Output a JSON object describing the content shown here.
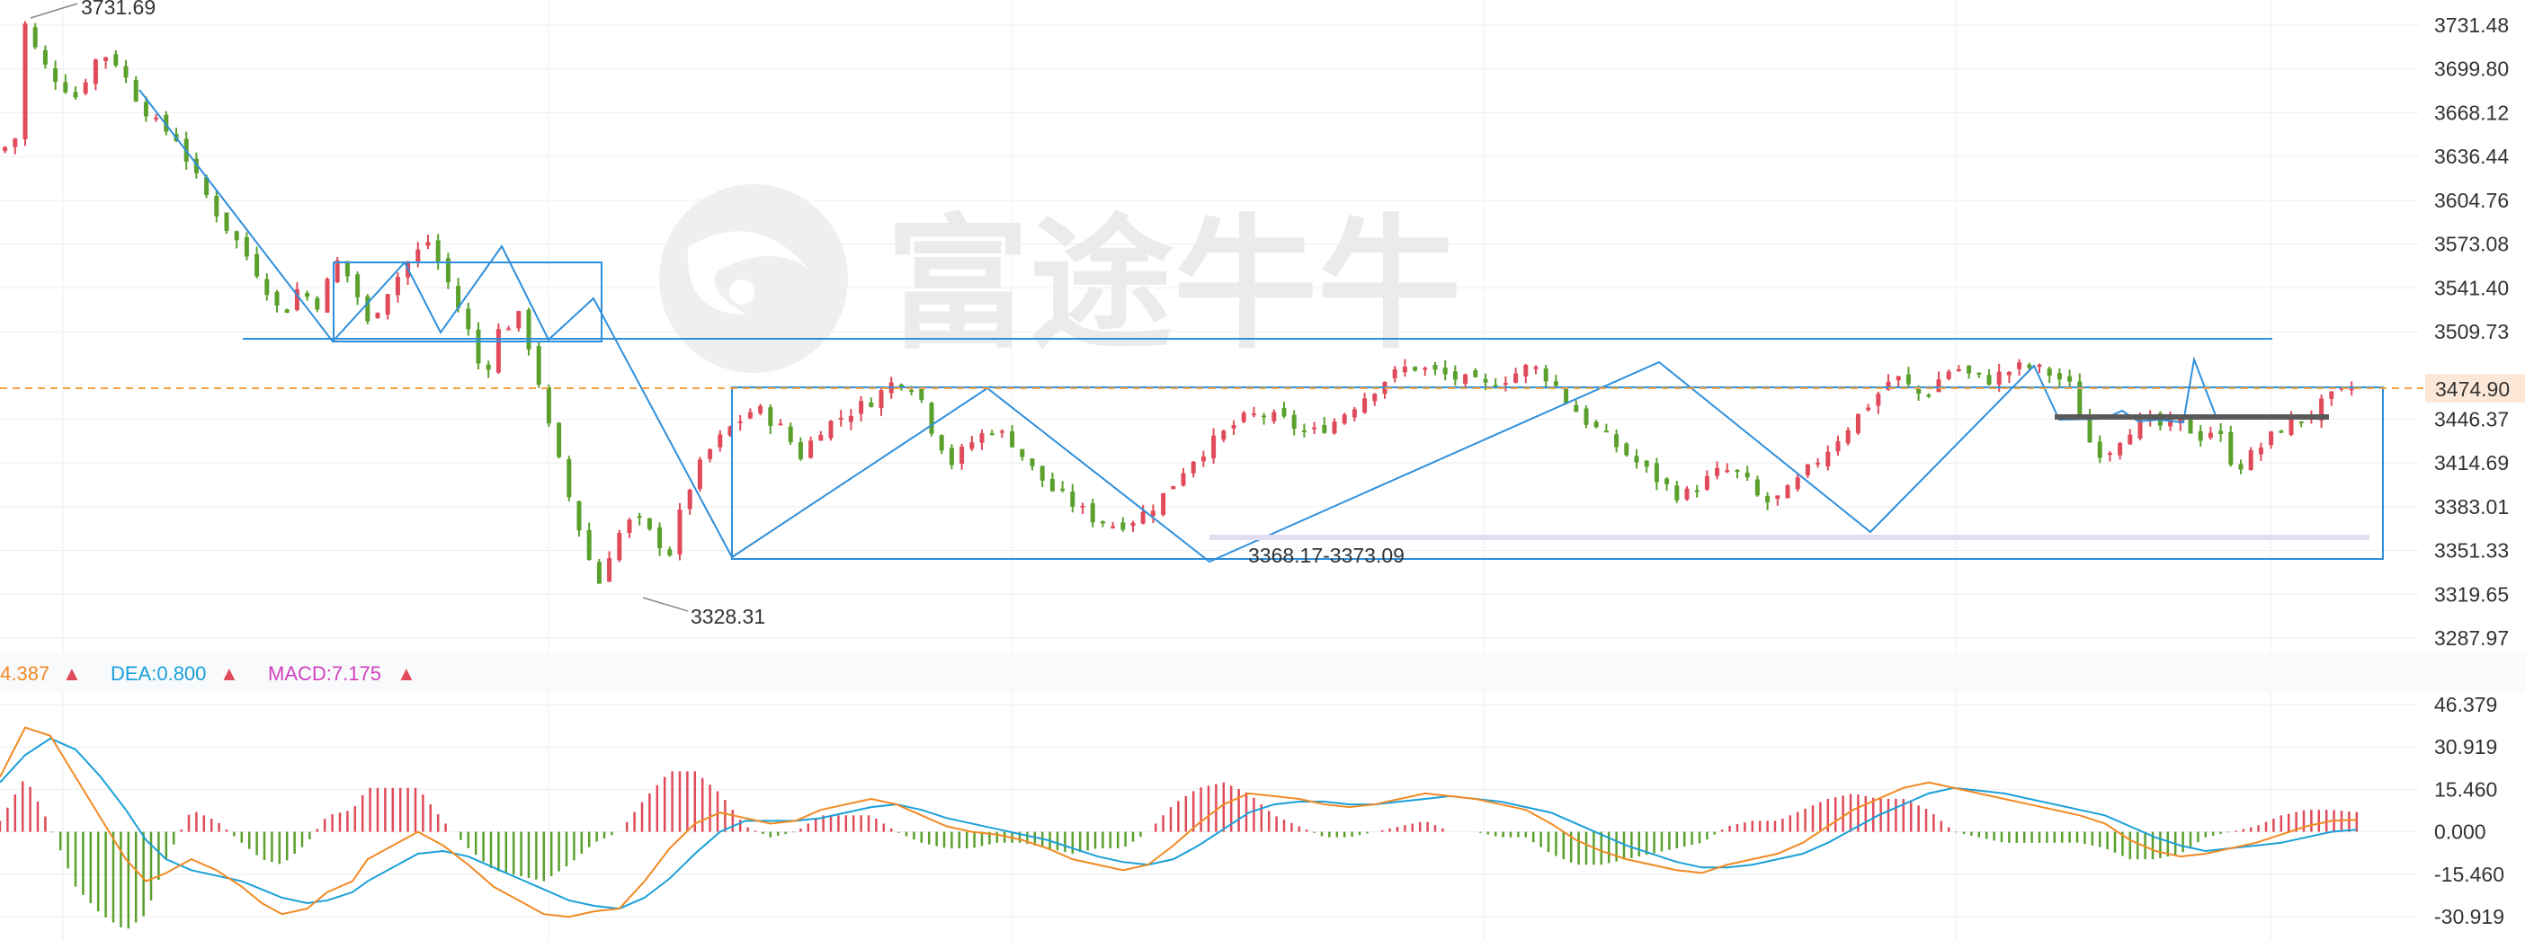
{
  "watermark": {
    "text": "富途牛牛"
  },
  "colors": {
    "up": "#e04a5a",
    "down": "#5aa02c",
    "drawing": "#2f8fdb",
    "current_line": "#f5a142",
    "current_bg": "#fde8d8",
    "current_text": "#e5322d",
    "dif": "#f08a24",
    "dea": "#1aa0d8",
    "macd_label": "#d040c0",
    "grid": "#eeeeee"
  },
  "price_axis": {
    "ticks": [
      "3731.48",
      "3699.80",
      "3668.12",
      "3636.44",
      "3604.76",
      "3573.08",
      "3541.40",
      "3509.73",
      "3446.37",
      "3414.69",
      "3383.01",
      "3351.33",
      "3319.65",
      "3287.97"
    ],
    "current_price": "3474.90"
  },
  "annotations": {
    "high": "3731.69",
    "low": "3328.31",
    "range": "3368.17-3373.09"
  },
  "indicator": {
    "dif_label": ":4.387",
    "dif_arrow": "▲",
    "dea_label": "DEA:0.800",
    "dea_arrow": "▲",
    "macd_label": "MACD:7.175",
    "macd_arrow": "▲",
    "ticks": [
      "46.379",
      "30.919",
      "15.460",
      "0.000",
      "-15.460",
      "-30.919"
    ]
  },
  "chart_data": {
    "type": "candlestick",
    "price_range": [
      3287.97,
      3731.48
    ],
    "close_path": [
      [
        0,
        3640
      ],
      [
        6,
        3650
      ],
      [
        10,
        3731.69
      ],
      [
        16,
        3705
      ],
      [
        24,
        3690
      ],
      [
        30,
        3680
      ],
      [
        36,
        3700
      ],
      [
        40,
        3712
      ],
      [
        46,
        3705
      ],
      [
        54,
        3680
      ],
      [
        62,
        3660
      ],
      [
        70,
        3650
      ],
      [
        78,
        3620
      ],
      [
        88,
        3590
      ],
      [
        96,
        3570
      ],
      [
        104,
        3548
      ],
      [
        112,
        3520
      ],
      [
        118,
        3540
      ],
      [
        126,
        3530
      ],
      [
        134,
        3560
      ],
      [
        140,
        3545
      ],
      [
        146,
        3515
      ],
      [
        154,
        3540
      ],
      [
        162,
        3560
      ],
      [
        170,
        3575
      ],
      [
        178,
        3545
      ],
      [
        186,
        3510
      ],
      [
        192,
        3475
      ],
      [
        198,
        3510
      ],
      [
        206,
        3520
      ],
      [
        212,
        3490
      ],
      [
        218,
        3440
      ],
      [
        226,
        3390
      ],
      [
        234,
        3345
      ],
      [
        238,
        3328.31
      ],
      [
        244,
        3360
      ],
      [
        252,
        3375
      ],
      [
        260,
        3360
      ],
      [
        266,
        3350
      ],
      [
        272,
        3390
      ],
      [
        280,
        3420
      ],
      [
        290,
        3440
      ],
      [
        300,
        3455
      ],
      [
        310,
        3440
      ],
      [
        318,
        3420
      ],
      [
        326,
        3440
      ],
      [
        336,
        3450
      ],
      [
        346,
        3460
      ],
      [
        356,
        3475
      ],
      [
        364,
        3470
      ],
      [
        370,
        3440
      ],
      [
        378,
        3415
      ],
      [
        386,
        3430
      ],
      [
        394,
        3440
      ],
      [
        402,
        3430
      ],
      [
        410,
        3410
      ],
      [
        418,
        3395
      ],
      [
        426,
        3385
      ],
      [
        434,
        3375
      ],
      [
        442,
        3370
      ],
      [
        448,
        3372
      ],
      [
        456,
        3380
      ],
      [
        464,
        3395
      ],
      [
        472,
        3415
      ],
      [
        482,
        3430
      ],
      [
        492,
        3445
      ],
      [
        500,
        3450
      ],
      [
        510,
        3445
      ],
      [
        520,
        3435
      ],
      [
        530,
        3445
      ],
      [
        540,
        3460
      ],
      [
        550,
        3475
      ],
      [
        560,
        3485
      ],
      [
        570,
        3480
      ],
      [
        580,
        3475
      ],
      [
        590,
        3470
      ],
      [
        600,
        3478
      ],
      [
        608,
        3485
      ],
      [
        616,
        3475
      ],
      [
        622,
        3460
      ],
      [
        630,
        3445
      ],
      [
        640,
        3430
      ],
      [
        650,
        3415
      ],
      [
        660,
        3400
      ],
      [
        668,
        3390
      ],
      [
        676,
        3400
      ],
      [
        684,
        3410
      ],
      [
        692,
        3405
      ],
      [
        700,
        3385
      ],
      [
        708,
        3390
      ],
      [
        716,
        3405
      ],
      [
        726,
        3425
      ],
      [
        736,
        3445
      ],
      [
        746,
        3465
      ],
      [
        752,
        3478
      ],
      [
        758,
        3470
      ],
      [
        764,
        3462
      ],
      [
        770,
        3475
      ],
      [
        776,
        3485
      ],
      [
        782,
        3478
      ],
      [
        790,
        3475
      ],
      [
        796,
        3480
      ],
      [
        804,
        3485
      ],
      [
        810,
        3482
      ],
      [
        816,
        3478
      ],
      [
        822,
        3470
      ],
      [
        830,
        3430
      ],
      [
        836,
        3420
      ],
      [
        840,
        3430
      ],
      [
        846,
        3440
      ],
      [
        852,
        3445
      ],
      [
        860,
        3440
      ],
      [
        868,
        3445
      ],
      [
        872,
        3432
      ],
      [
        880,
        3440
      ],
      [
        884,
        3425
      ],
      [
        888,
        3410
      ],
      [
        894,
        3420
      ],
      [
        900,
        3430
      ],
      [
        906,
        3440
      ],
      [
        912,
        3445
      ],
      [
        918,
        3450
      ],
      [
        924,
        3460
      ],
      [
        930,
        3465
      ],
      [
        936,
        3470
      ]
    ],
    "macd_range": [
      -30.919,
      46.379
    ],
    "dif_path": [
      [
        0,
        20
      ],
      [
        10,
        38
      ],
      [
        20,
        35
      ],
      [
        30,
        20
      ],
      [
        40,
        5
      ],
      [
        50,
        -10
      ],
      [
        58,
        -18
      ],
      [
        66,
        -15
      ],
      [
        76,
        -10
      ],
      [
        86,
        -14
      ],
      [
        96,
        -20
      ],
      [
        104,
        -26
      ],
      [
        112,
        -30
      ],
      [
        122,
        -28
      ],
      [
        130,
        -22
      ],
      [
        140,
        -18
      ],
      [
        146,
        -10
      ],
      [
        156,
        -5
      ],
      [
        166,
        0
      ],
      [
        176,
        -5
      ],
      [
        186,
        -12
      ],
      [
        196,
        -20
      ],
      [
        206,
        -25
      ],
      [
        216,
        -30
      ],
      [
        226,
        -31
      ],
      [
        236,
        -29
      ],
      [
        246,
        -28
      ],
      [
        256,
        -18
      ],
      [
        266,
        -6
      ],
      [
        276,
        3
      ],
      [
        286,
        7
      ],
      [
        296,
        5
      ],
      [
        306,
        3
      ],
      [
        316,
        4
      ],
      [
        326,
        8
      ],
      [
        336,
        10
      ],
      [
        346,
        12
      ],
      [
        356,
        10
      ],
      [
        366,
        6
      ],
      [
        376,
        2
      ],
      [
        386,
        0
      ],
      [
        396,
        -1
      ],
      [
        406,
        -3
      ],
      [
        416,
        -6
      ],
      [
        426,
        -10
      ],
      [
        436,
        -12
      ],
      [
        446,
        -14
      ],
      [
        456,
        -12
      ],
      [
        466,
        -5
      ],
      [
        476,
        3
      ],
      [
        486,
        10
      ],
      [
        496,
        14
      ],
      [
        506,
        13
      ],
      [
        516,
        12
      ],
      [
        526,
        10
      ],
      [
        536,
        9
      ],
      [
        546,
        10
      ],
      [
        556,
        12
      ],
      [
        566,
        14
      ],
      [
        576,
        13
      ],
      [
        586,
        12
      ],
      [
        596,
        10
      ],
      [
        606,
        8
      ],
      [
        616,
        3
      ],
      [
        626,
        -3
      ],
      [
        636,
        -7
      ],
      [
        646,
        -10
      ],
      [
        656,
        -12
      ],
      [
        666,
        -14
      ],
      [
        676,
        -15
      ],
      [
        686,
        -12
      ],
      [
        696,
        -10
      ],
      [
        706,
        -8
      ],
      [
        716,
        -4
      ],
      [
        726,
        2
      ],
      [
        736,
        8
      ],
      [
        746,
        12
      ],
      [
        756,
        16
      ],
      [
        766,
        18
      ],
      [
        776,
        16
      ],
      [
        786,
        14
      ],
      [
        796,
        12
      ],
      [
        806,
        10
      ],
      [
        816,
        8
      ],
      [
        826,
        6
      ],
      [
        836,
        3
      ],
      [
        846,
        -3
      ],
      [
        856,
        -7
      ],
      [
        866,
        -9
      ],
      [
        876,
        -8
      ],
      [
        886,
        -6
      ],
      [
        896,
        -4
      ],
      [
        906,
        -1
      ],
      [
        916,
        2
      ],
      [
        926,
        4
      ],
      [
        936,
        4.387
      ]
    ],
    "dea_path": [
      [
        0,
        18
      ],
      [
        10,
        28
      ],
      [
        20,
        34
      ],
      [
        30,
        30
      ],
      [
        40,
        20
      ],
      [
        50,
        8
      ],
      [
        58,
        -3
      ],
      [
        66,
        -10
      ],
      [
        76,
        -14
      ],
      [
        86,
        -16
      ],
      [
        96,
        -18
      ],
      [
        104,
        -21
      ],
      [
        112,
        -24
      ],
      [
        122,
        -26
      ],
      [
        130,
        -25
      ],
      [
        140,
        -22
      ],
      [
        146,
        -18
      ],
      [
        156,
        -13
      ],
      [
        166,
        -8
      ],
      [
        176,
        -7
      ],
      [
        186,
        -9
      ],
      [
        196,
        -13
      ],
      [
        206,
        -17
      ],
      [
        216,
        -21
      ],
      [
        226,
        -25
      ],
      [
        236,
        -27
      ],
      [
        246,
        -28
      ],
      [
        256,
        -24
      ],
      [
        266,
        -17
      ],
      [
        276,
        -8
      ],
      [
        286,
        0
      ],
      [
        296,
        4
      ],
      [
        306,
        4
      ],
      [
        316,
        4
      ],
      [
        326,
        5
      ],
      [
        336,
        7
      ],
      [
        346,
        9
      ],
      [
        356,
        10
      ],
      [
        366,
        8
      ],
      [
        376,
        5
      ],
      [
        386,
        3
      ],
      [
        396,
        1
      ],
      [
        406,
        -1
      ],
      [
        416,
        -3
      ],
      [
        426,
        -6
      ],
      [
        436,
        -9
      ],
      [
        446,
        -11
      ],
      [
        456,
        -12
      ],
      [
        466,
        -10
      ],
      [
        476,
        -5
      ],
      [
        486,
        1
      ],
      [
        496,
        7
      ],
      [
        506,
        10
      ],
      [
        516,
        11
      ],
      [
        526,
        11
      ],
      [
        536,
        10
      ],
      [
        546,
        10
      ],
      [
        556,
        11
      ],
      [
        566,
        12
      ],
      [
        576,
        13
      ],
      [
        586,
        12
      ],
      [
        596,
        11
      ],
      [
        606,
        9
      ],
      [
        616,
        7
      ],
      [
        626,
        3
      ],
      [
        636,
        -1
      ],
      [
        646,
        -5
      ],
      [
        656,
        -8
      ],
      [
        666,
        -11
      ],
      [
        676,
        -13
      ],
      [
        686,
        -13
      ],
      [
        696,
        -12
      ],
      [
        706,
        -10
      ],
      [
        716,
        -8
      ],
      [
        726,
        -4
      ],
      [
        736,
        1
      ],
      [
        746,
        6
      ],
      [
        756,
        10
      ],
      [
        766,
        14
      ],
      [
        776,
        16
      ],
      [
        786,
        15
      ],
      [
        796,
        14
      ],
      [
        806,
        12
      ],
      [
        816,
        10
      ],
      [
        826,
        8
      ],
      [
        836,
        6
      ],
      [
        846,
        2
      ],
      [
        856,
        -2
      ],
      [
        866,
        -5
      ],
      [
        876,
        -7
      ],
      [
        886,
        -6
      ],
      [
        896,
        -5
      ],
      [
        906,
        -4
      ],
      [
        916,
        -2
      ],
      [
        926,
        0
      ],
      [
        936,
        0.8
      ]
    ]
  }
}
